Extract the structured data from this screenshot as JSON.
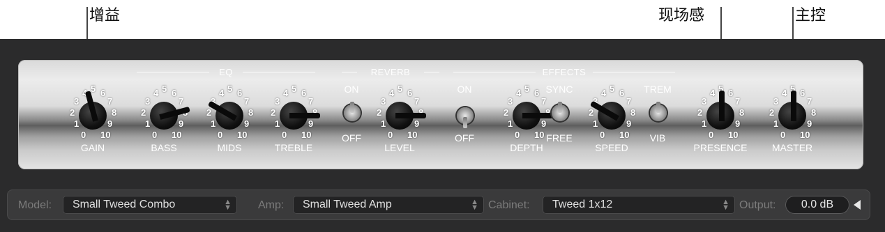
{
  "callouts": {
    "gain": "增益",
    "presence": "现场感",
    "master": "主控"
  },
  "sections": {
    "eq": "EQ",
    "reverb": "REVERB",
    "effects": "EFFECTS"
  },
  "knob_scale": [
    "0",
    "1",
    "2",
    "3",
    "4",
    "5",
    "6",
    "7",
    "8",
    "9",
    "10"
  ],
  "knobs": {
    "gain": {
      "label": "GAIN",
      "value": 4.5
    },
    "bass": {
      "label": "BASS",
      "value": 7.5
    },
    "mids": {
      "label": "MIDS",
      "value": 3
    },
    "treble": {
      "label": "TREBLE",
      "value": 8
    },
    "level": {
      "label": "LEVEL",
      "value": 8
    },
    "depth": {
      "label": "DEPTH",
      "value": 8
    },
    "speed": {
      "label": "SPEED",
      "value": 3
    },
    "presence": {
      "label": "PRESENCE",
      "value": 5
    },
    "master": {
      "label": "MASTER",
      "value": 5
    }
  },
  "toggles": {
    "reverb": {
      "on": "ON",
      "off": "OFF"
    },
    "effects": {
      "on": "ON",
      "off": "OFF"
    },
    "sync": {
      "on": "SYNC",
      "off": "FREE"
    },
    "trem": {
      "on": "TREM",
      "off": "VIB"
    }
  },
  "bottom": {
    "model_label": "Model:",
    "model_value": "Small Tweed Combo",
    "amp_label": "Amp:",
    "amp_value": "Small Tweed Amp",
    "cabinet_label": "Cabinet:",
    "cabinet_value": "Tweed 1x12",
    "output_label": "Output:",
    "output_value": "0.0 dB"
  }
}
